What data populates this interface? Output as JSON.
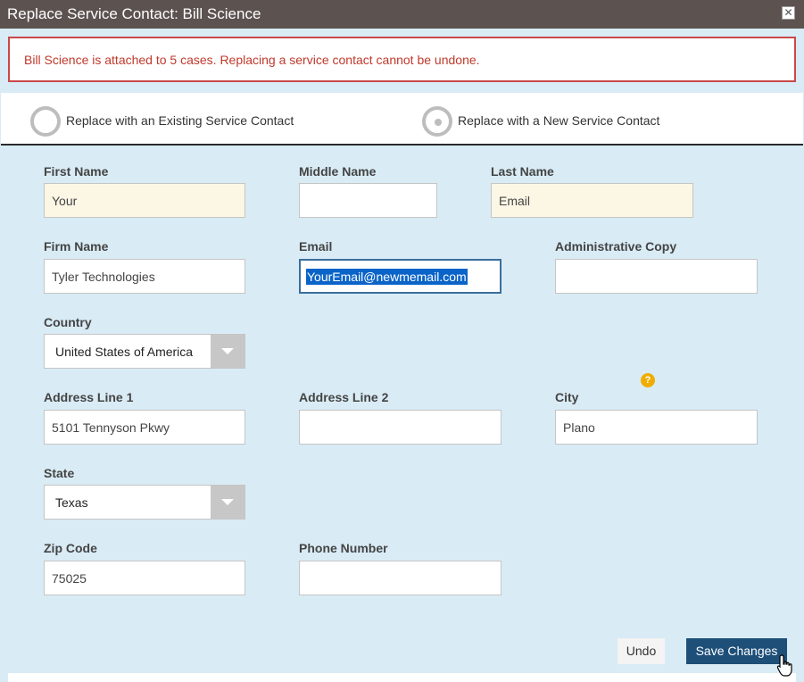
{
  "dialog": {
    "title": "Replace Service Contact: Bill Science",
    "close_label": "✕",
    "alert": "Bill Science is attached to 5 cases. Replacing a service contact cannot be undone."
  },
  "options": {
    "existing_label": "Replace with an Existing Service Contact",
    "new_label": "Replace with a New Service Contact",
    "selected": "new"
  },
  "labels": {
    "first_name": "First Name",
    "middle_name": "Middle Name",
    "last_name": "Last Name",
    "firm_name": "Firm Name",
    "email": "Email",
    "admin_copy": "Administrative Copy",
    "country": "Country",
    "address1": "Address Line 1",
    "address2": "Address Line 2",
    "city": "City",
    "state": "State",
    "zip": "Zip Code",
    "phone": "Phone Number"
  },
  "values": {
    "first_name": "Your",
    "middle_name": "",
    "last_name": "Email",
    "firm_name": "Tyler Technologies",
    "email": "YourEmail@newmemail.com",
    "admin_copy": "",
    "country": "United States of America",
    "address1": "5101 Tennyson Pkwy",
    "address2": "",
    "city": "Plano",
    "state": "Texas",
    "zip": "75025",
    "phone": ""
  },
  "help_icon": "?",
  "buttons": {
    "undo": "Undo",
    "save": "Save Changes"
  },
  "colors": {
    "title_bar": "#5c5250",
    "alert_border": "#c9484a",
    "form_bg": "#d9ebf5",
    "required_bg": "#fcf6e5",
    "primary_button": "#1d4f79",
    "help_icon": "#f0ad00"
  }
}
